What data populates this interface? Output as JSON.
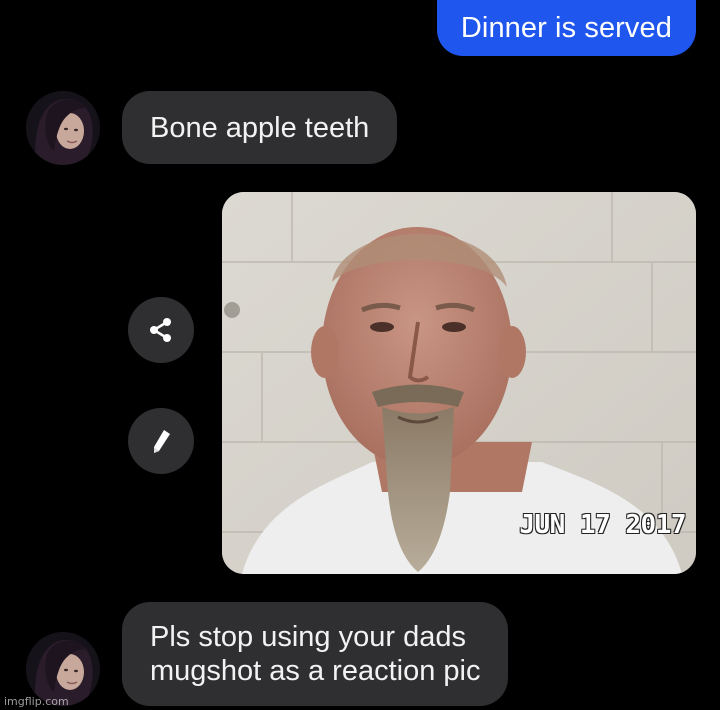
{
  "conversation": {
    "messages": [
      {
        "sender": "self",
        "text": "Dinner is served"
      },
      {
        "sender": "other",
        "text": "Bone apple teeth"
      },
      {
        "sender": "other",
        "type": "image",
        "image_description_icon": "mugshot-photo",
        "date_stamp": "JUN 17 2017"
      },
      {
        "sender": "other",
        "lines": [
          "Pls stop using your dads",
          "mugshot as a reaction pic"
        ]
      }
    ],
    "actions": {
      "share_icon": "share-icon",
      "edit_icon": "pencil-icon"
    }
  },
  "watermark": "imgflip.com",
  "colors": {
    "background": "#000000",
    "sent_bubble": "#1f56ee",
    "received_bubble": "#2f2f31",
    "text": "#ffffff"
  }
}
